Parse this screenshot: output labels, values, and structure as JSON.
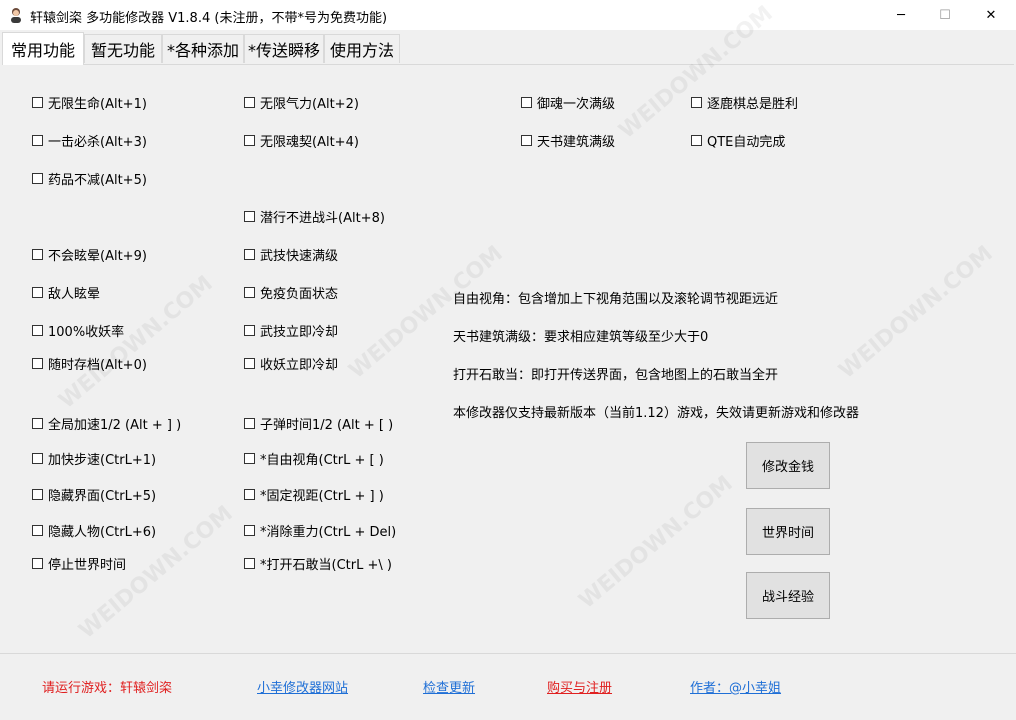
{
  "window": {
    "title": "轩辕剑栥 多功能修改器  V1.8.4  (未注册，不带*号为免费功能)",
    "minimize": "─",
    "maximize": "☐",
    "close": "✕"
  },
  "tabs": [
    "常用功能",
    "暂无功能",
    "*各种添加",
    "*传送瞬移",
    "使用方法"
  ],
  "options": [
    "无限生命(Alt+1)",
    "一击必杀(Alt+3)",
    "药品不减(Alt+5)",
    "不会眩晕(Alt+9)",
    "敌人眩晕",
    "100%收妖率",
    "随时存档(Alt+0)",
    "全局加速1/2 (Alt + ] )",
    "加快步速(CtrL+1)",
    "隐藏界面(CtrL+5)",
    "隐藏人物(CtrL+6)",
    "停止世界时间",
    "无限气力(Alt+2)",
    "无限魂契(Alt+4)",
    "潜行不进战斗(Alt+8)",
    "武技快速满级",
    "免疫负面状态",
    "武技立即冷却",
    "收妖立即冷却",
    "子弹时间1/2 (Alt + [ )",
    "*自由视角(CtrL + [ )",
    "*固定视距(CtrL + ] )",
    "*消除重力(CtrL + Del)",
    "*打开石敢当(CtrL +\\ )",
    "御魂一次满级",
    "天书建筑满级",
    "逐鹿棋总是胜利",
    "QTE自动完成"
  ],
  "info": [
    "自由视角：包含增加上下视角范围以及滚轮调节视距远近",
    "天书建筑满级：要求相应建筑等级至少大于0",
    "打开石敢当：即打开传送界面，包含地图上的石敢当全开",
    "本修改器仅支持最新版本（当前1.12）游戏，失效请更新游戏和修改器"
  ],
  "buttons": [
    "修改金钱",
    "世界时间",
    "战斗经验"
  ],
  "footer": {
    "status": "请运行游戏：轩辕剑栥",
    "site": "小幸修改器网站",
    "update": "检查更新",
    "buy": "购买与注册",
    "author": "作者：@小幸姐"
  },
  "watermark": "WEIDOWN.COM",
  "colors": {
    "status": "#e02020",
    "link": "#1f6fd6"
  }
}
